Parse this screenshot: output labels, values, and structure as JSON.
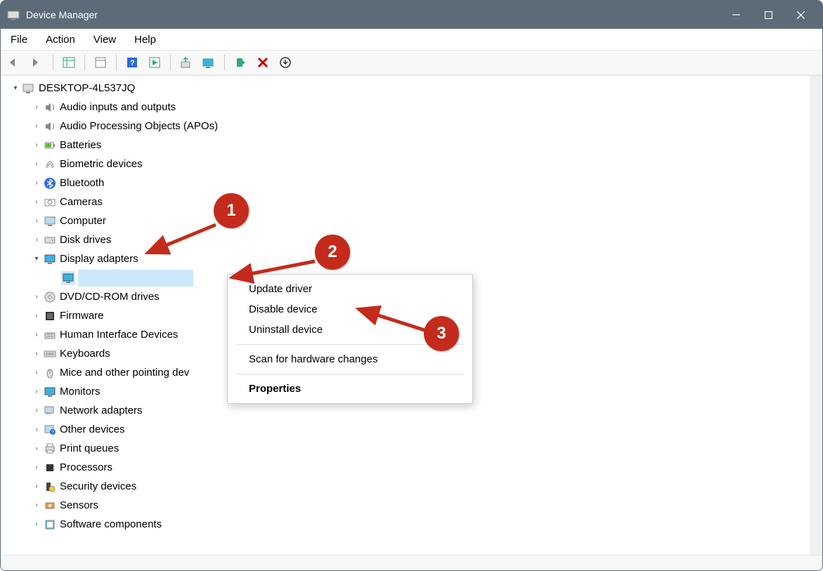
{
  "window": {
    "title": "Device Manager"
  },
  "menubar": [
    "File",
    "Action",
    "View",
    "Help"
  ],
  "tree": {
    "root": "DESKTOP-4L537JQ",
    "nodes": [
      {
        "label": "Audio inputs and outputs",
        "icon": "speaker"
      },
      {
        "label": "Audio Processing Objects (APOs)",
        "icon": "speaker"
      },
      {
        "label": "Batteries",
        "icon": "battery"
      },
      {
        "label": "Biometric devices",
        "icon": "fingerprint"
      },
      {
        "label": "Bluetooth",
        "icon": "bluetooth"
      },
      {
        "label": "Cameras",
        "icon": "camera"
      },
      {
        "label": "Computer",
        "icon": "computer"
      },
      {
        "label": "Disk drives",
        "icon": "disk"
      },
      {
        "label": "Display adapters",
        "icon": "display",
        "expanded": true,
        "children": [
          {
            "label": "",
            "icon": "display",
            "selected": true
          }
        ]
      },
      {
        "label": "DVD/CD-ROM drives",
        "icon": "dvd"
      },
      {
        "label": "Firmware",
        "icon": "firmware"
      },
      {
        "label": "Human Interface Devices",
        "icon": "hid"
      },
      {
        "label": "Keyboards",
        "icon": "keyboard"
      },
      {
        "label": "Mice and other pointing devices",
        "icon": "mouse",
        "truncated": "Mice and other pointing dev"
      },
      {
        "label": "Monitors",
        "icon": "display"
      },
      {
        "label": "Network adapters",
        "icon": "network"
      },
      {
        "label": "Other devices",
        "icon": "other"
      },
      {
        "label": "Print queues",
        "icon": "printer"
      },
      {
        "label": "Processors",
        "icon": "cpu"
      },
      {
        "label": "Security devices",
        "icon": "security"
      },
      {
        "label": "Sensors",
        "icon": "sensor"
      },
      {
        "label": "Software components",
        "icon": "software"
      }
    ]
  },
  "context_menu": {
    "items": [
      {
        "label": "Update driver"
      },
      {
        "label": "Disable device"
      },
      {
        "label": "Uninstall device"
      },
      {
        "sep": true
      },
      {
        "label": "Scan for hardware changes"
      },
      {
        "sep": true
      },
      {
        "label": "Properties",
        "bold": true
      }
    ]
  },
  "annotations": {
    "n1": "1",
    "n2": "2",
    "n3": "3"
  }
}
